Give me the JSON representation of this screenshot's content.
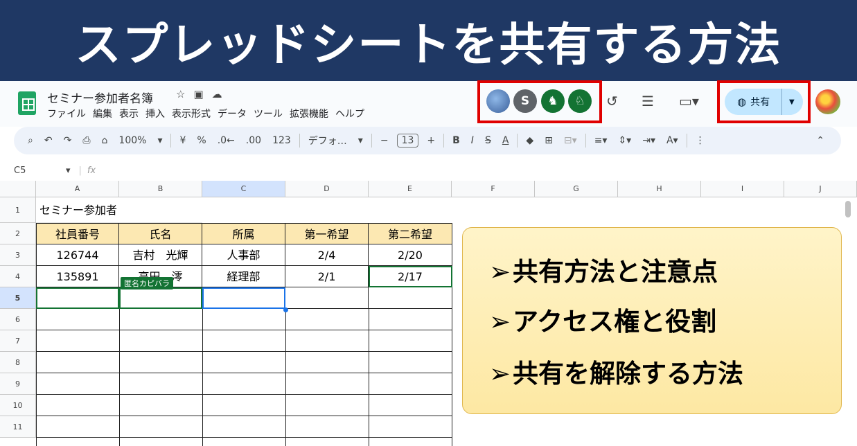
{
  "banner": {
    "title": "スプレッドシートを共有する方法"
  },
  "app": {
    "doc_title": "セミナー参加者名簿",
    "menu": [
      "ファイル",
      "編集",
      "表示",
      "挿入",
      "表示形式",
      "データ",
      "ツール",
      "拡張機能",
      "ヘルプ"
    ],
    "avatar_s_letter": "S",
    "share_label": "共有"
  },
  "toolbar": {
    "zoom": "100%",
    "currency": "¥",
    "percent": "%",
    "dec_minus": ".0←",
    "dec_plus": ".00",
    "number_format": "123",
    "font_name": "デフォ…",
    "font_size": "13",
    "minus": "−",
    "plus": "+",
    "bold": "B",
    "italic": "I",
    "strike": "S",
    "text_color": "A"
  },
  "formula": {
    "cell_ref": "C5",
    "fx": "fx"
  },
  "grid": {
    "columns": [
      "A",
      "B",
      "C",
      "D",
      "E",
      "F",
      "G",
      "H",
      "I",
      "J"
    ],
    "rows": [
      "1",
      "2",
      "3",
      "4",
      "5",
      "6",
      "7",
      "8",
      "9",
      "10",
      "11"
    ],
    "title_cell": "セミナー参加者",
    "headers": [
      "社員番号",
      "氏名",
      "所属",
      "第一希望",
      "第二希望"
    ],
    "data": [
      [
        "126744",
        "吉村　光輝",
        "人事部",
        "2/4",
        "2/20"
      ],
      [
        "135891",
        "高田　澪",
        "経理部",
        "2/1",
        "2/17"
      ]
    ],
    "collab_tag": "匿名カピバラ"
  },
  "callout": {
    "points": [
      "共有方法と注意点",
      "アクセス権と役割",
      "共有を解除する方法"
    ]
  }
}
